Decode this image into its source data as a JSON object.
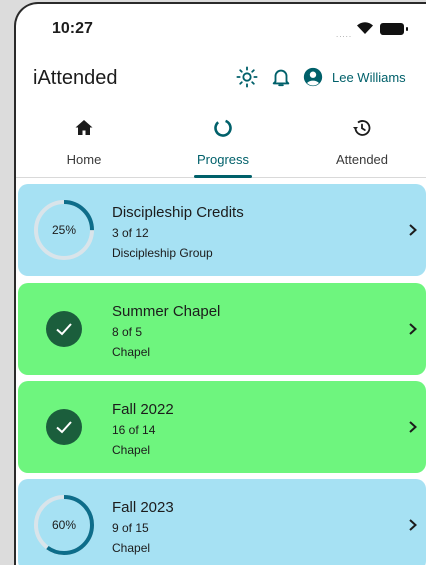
{
  "status_bar": {
    "time": "10:27",
    "signal": "....."
  },
  "app_bar": {
    "title": "iAttended",
    "user_name": "Lee Williams",
    "icons": [
      "brightness-icon",
      "bell-icon",
      "account-icon"
    ]
  },
  "tabs": [
    {
      "label": "Home",
      "icon": "home-icon",
      "active": false
    },
    {
      "label": "Progress",
      "icon": "progress-icon",
      "active": true
    },
    {
      "label": "Attended",
      "icon": "history-icon",
      "active": false
    }
  ],
  "colors": {
    "accent": "#00606a",
    "card_in_progress": "#a6e1f3",
    "card_complete": "#6ef57e",
    "check_badge": "#1b5e3c"
  },
  "cards": [
    {
      "title": "Discipleship Credits",
      "count": "3 of 12",
      "type": "Discipleship Group",
      "status": "in-progress",
      "percent_label": "25%",
      "progress": 0.25
    },
    {
      "title": "Summer Chapel",
      "count": "8 of 5",
      "type": "Chapel",
      "status": "complete"
    },
    {
      "title": "Fall 2022",
      "count": "16 of 14",
      "type": "Chapel",
      "status": "complete"
    },
    {
      "title": "Fall 2023",
      "count": "9 of 15",
      "type": "Chapel",
      "status": "in-progress",
      "percent_label": "60%",
      "progress": 0.6
    }
  ]
}
